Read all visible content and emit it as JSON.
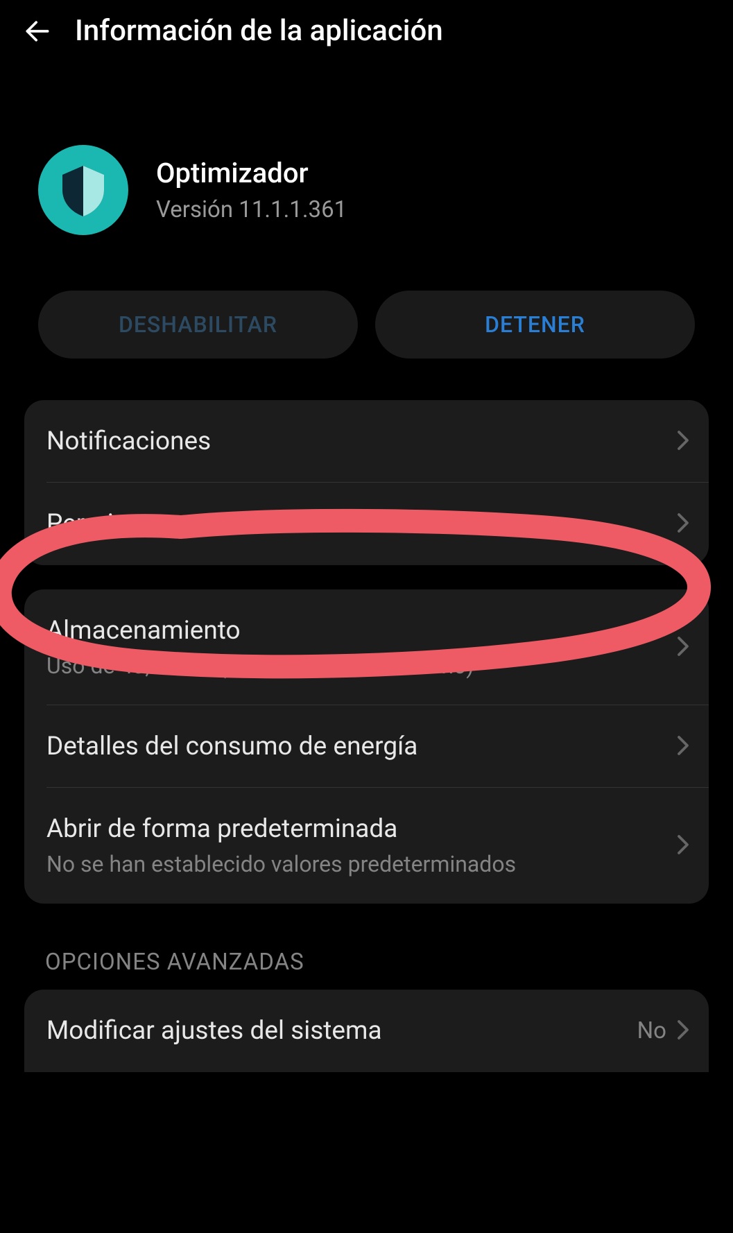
{
  "header": {
    "title": "Información de la aplicación"
  },
  "app": {
    "name": "Optimizador",
    "version": "Versión 11.1.1.361"
  },
  "buttons": {
    "disable": "DESHABILITAR",
    "stop": "DETENER"
  },
  "group1": {
    "notifications": "Notificaciones",
    "permissions": "Permisos"
  },
  "group2": {
    "storage_title": "Almacenamiento",
    "storage_subtitle": "Uso de 43,79  MB (almacenamiento interno)",
    "energy": "Detalles del consumo de energía",
    "default_open_title": "Abrir de forma predeterminada",
    "default_open_subtitle": "No se han establecido valores predeterminados"
  },
  "advanced": {
    "header": "OPCIONES AVANZADAS",
    "modify_system": "Modificar ajustes del sistema",
    "modify_system_value": "No"
  }
}
